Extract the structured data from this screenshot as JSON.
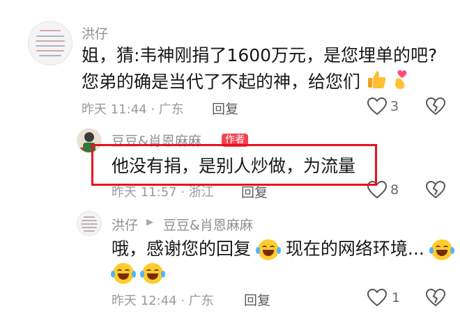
{
  "comments": [
    {
      "user": "洪仔",
      "line1": "姐，猜:韦神刚捐了1600万元，是您埋单的吧?",
      "line2": "您弟的确是当代了不起的神，给您们",
      "time": "昨天 11:44 · 广东",
      "reply_label": "回复",
      "likes": "3"
    },
    {
      "user": "豆豆&肖恩麻麻",
      "tag": "作者",
      "text": "他没有捐，是别人炒做，为流量",
      "time": "昨天 11:57 · 浙江",
      "reply_label": "回复",
      "likes": "8"
    },
    {
      "user": "洪仔",
      "arrow": "▶",
      "reply_to": "豆豆&肖恩麻麻",
      "text_a": "哦，感谢您的回复",
      "text_b": "现在的网络环境...",
      "time": "昨天 12:44 · 广东",
      "reply_label": "回复",
      "likes": "1"
    }
  ],
  "icons": [
    "heart-icon",
    "broken-heart-icon",
    "thumbs-up-emoji",
    "finger-heart-emoji",
    "laughing-crying-emoji"
  ],
  "colors": {
    "highlight": "#e8101c",
    "author_tag": "#f3424f"
  }
}
